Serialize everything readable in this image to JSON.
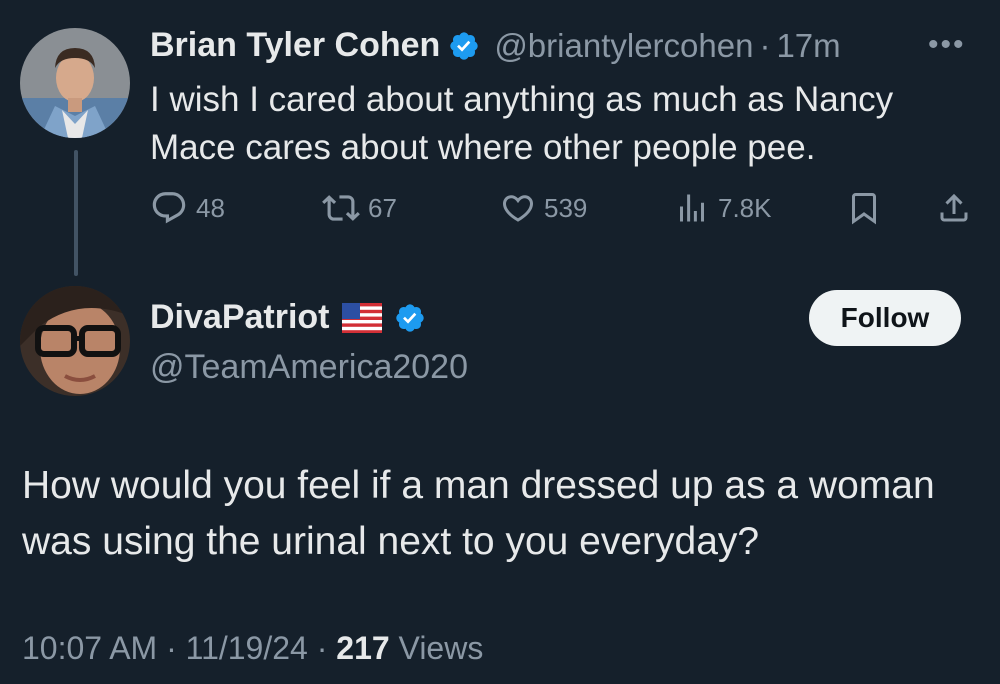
{
  "parent_tweet": {
    "display_name": "Brian Tyler Cohen",
    "handle": "@briantylercohen",
    "separator": "·",
    "time_ago": "17m",
    "more_label": "•••",
    "text": "I wish I cared about anything as much as Nancy Mace cares about where other people pee.",
    "stats": {
      "replies": "48",
      "reposts": "67",
      "likes": "539",
      "views": "7.8K"
    }
  },
  "main_tweet": {
    "display_name": "DivaPatriot",
    "flag_emoji": "us-flag-icon",
    "handle": "@TeamAmerica2020",
    "follow_label": "Follow",
    "text": "How would you feel if a man dressed up as a woman was using the urinal next to you everyday?",
    "meta": {
      "time": "10:07 AM",
      "date": "11/19/24",
      "sep1": "·",
      "sep2": "·",
      "views_count": "217",
      "views_label": "Views"
    }
  },
  "colors": {
    "background": "#15202b",
    "text_primary": "#e7e9ea",
    "text_secondary": "#8b98a5",
    "verified_blue": "#1d9bf0",
    "thread_line": "#425364",
    "follow_bg": "#eff3f4"
  }
}
